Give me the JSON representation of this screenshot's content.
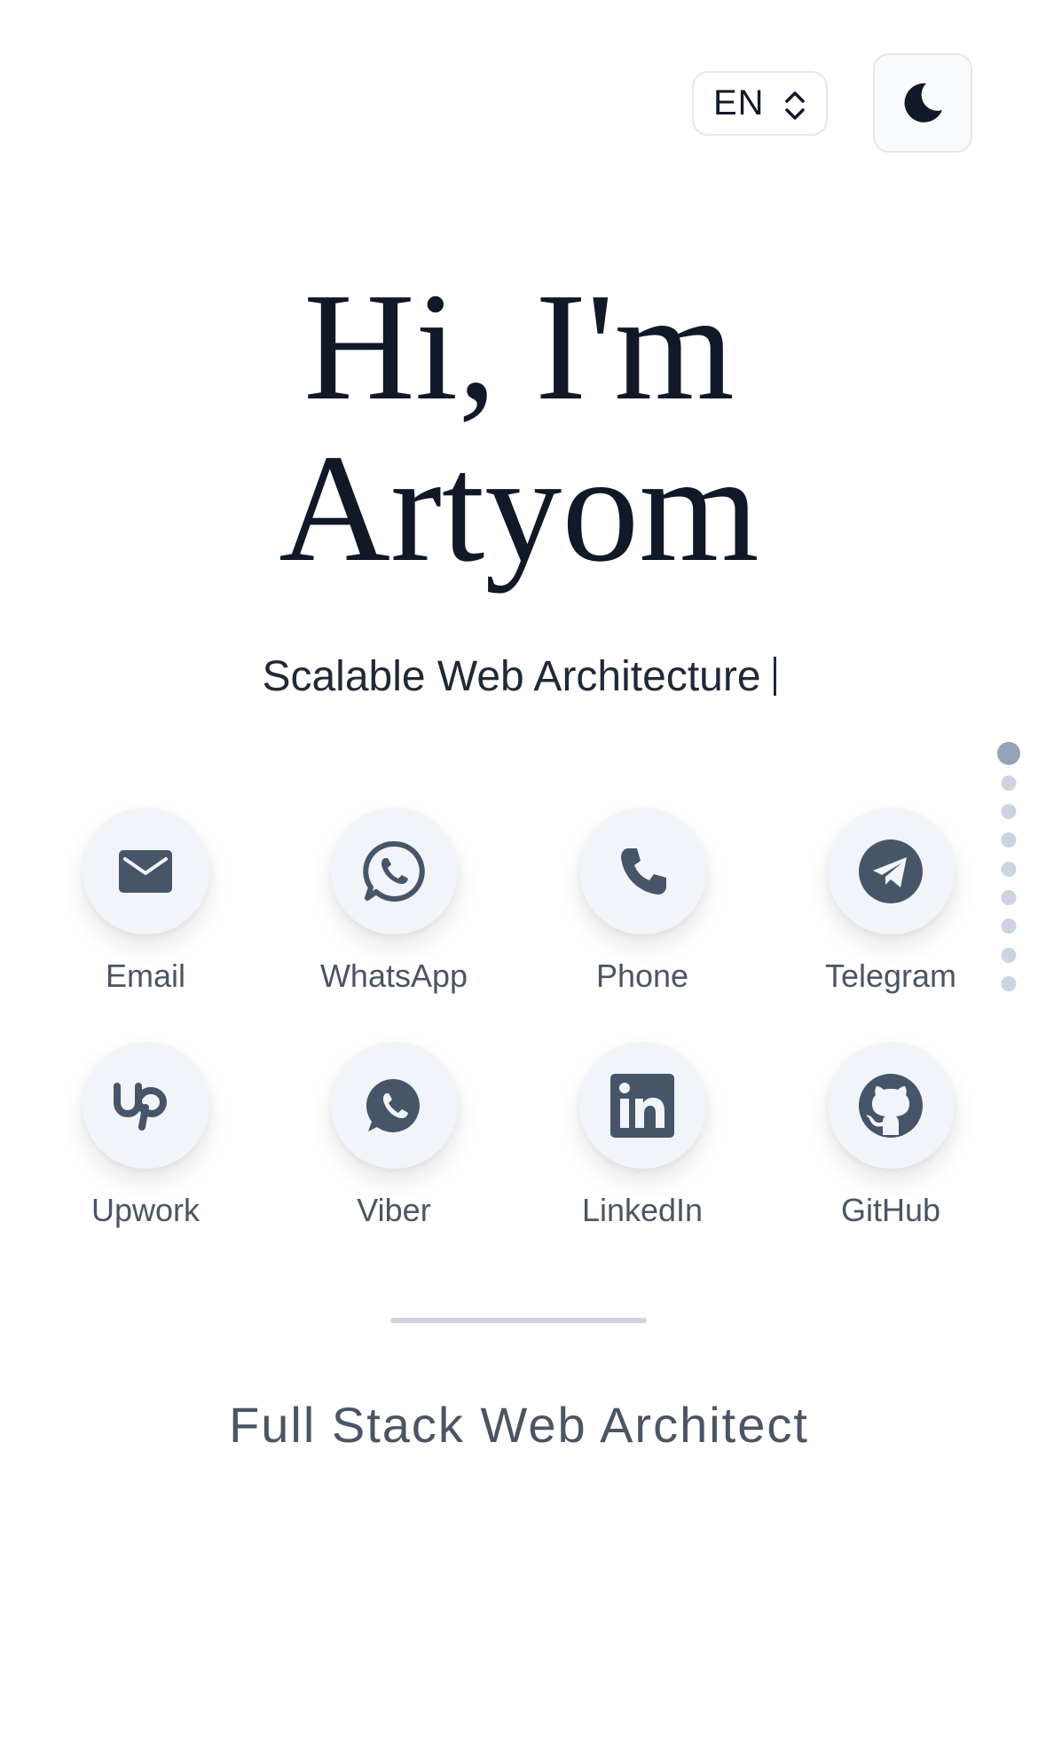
{
  "language_select": {
    "value": "EN"
  },
  "hero": {
    "line1": "Hi, I'm",
    "line2": "Artyom",
    "typing_text": "Scalable Web Architecture"
  },
  "contacts": [
    {
      "label": "Email",
      "icon": "mail-icon"
    },
    {
      "label": "WhatsApp",
      "icon": "whatsapp-icon"
    },
    {
      "label": "Phone",
      "icon": "phone-icon"
    },
    {
      "label": "Telegram",
      "icon": "telegram-icon"
    },
    {
      "label": "Upwork",
      "icon": "upwork-icon"
    },
    {
      "label": "Viber",
      "icon": "viber-icon"
    },
    {
      "label": "LinkedIn",
      "icon": "linkedin-icon"
    },
    {
      "label": "GitHub",
      "icon": "github-icon"
    }
  ],
  "section_dots": {
    "count": 9,
    "active_index": 0
  },
  "footer": {
    "role": "Full Stack Web Architect"
  },
  "colors": {
    "icon": "#475569",
    "circle_bg": "#f1f5f9",
    "dot_active": "#94a3b8",
    "dot_inactive": "#cbd5e1",
    "heading": "#111827"
  }
}
